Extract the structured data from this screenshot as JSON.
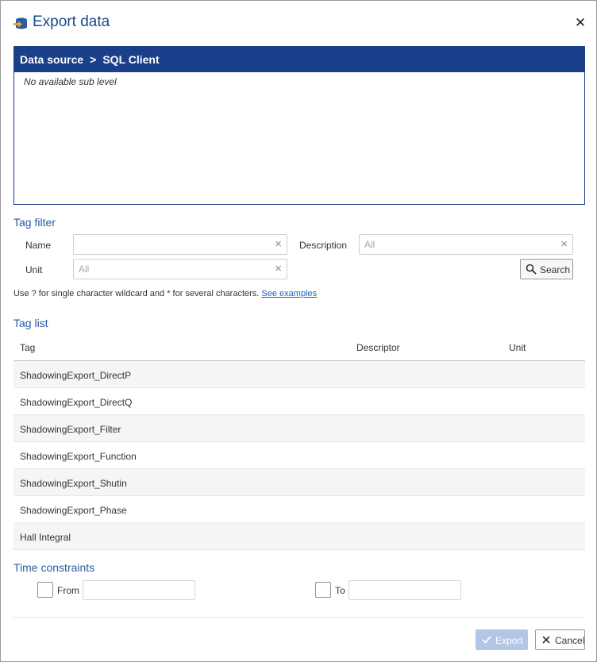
{
  "dialog": {
    "title": "Export data",
    "icon": "export-data-icon",
    "close_icon": "close-icon"
  },
  "data_source": {
    "root": "Data source",
    "separator": ">",
    "current": "SQL Client",
    "empty_text": "No available sub level"
  },
  "tag_filter": {
    "title": "Tag filter",
    "name_label": "Name",
    "name_value": "",
    "description_label": "Description",
    "description_placeholder": "All",
    "unit_label": "Unit",
    "unit_placeholder": "All",
    "search_label": "Search",
    "hint_text": "Use ? for single character wildcard and * for several characters.",
    "hint_link": "See examples"
  },
  "tag_list": {
    "title": "Tag list",
    "columns": [
      "Tag",
      "Descriptor",
      "Unit"
    ],
    "rows": [
      "ShadowingExport_DirectP",
      "ShadowingExport_DirectQ",
      "ShadowingExport_Filter",
      "ShadowingExport_Function",
      "ShadowingExport_Shutin",
      "ShadowingExport_Phase",
      "Hall Integral"
    ]
  },
  "time_constraints": {
    "title": "Time constraints",
    "from_label": "From",
    "to_label": "To"
  },
  "footer": {
    "export_label": "Export",
    "cancel_label": "Cancel"
  },
  "colors": {
    "header_blue": "#1b3f8a",
    "title_blue": "#1a4a8c",
    "section_blue": "#2a5aa0",
    "export_disabled": "#b4c6e4",
    "icon_orange": "#f0a030"
  }
}
